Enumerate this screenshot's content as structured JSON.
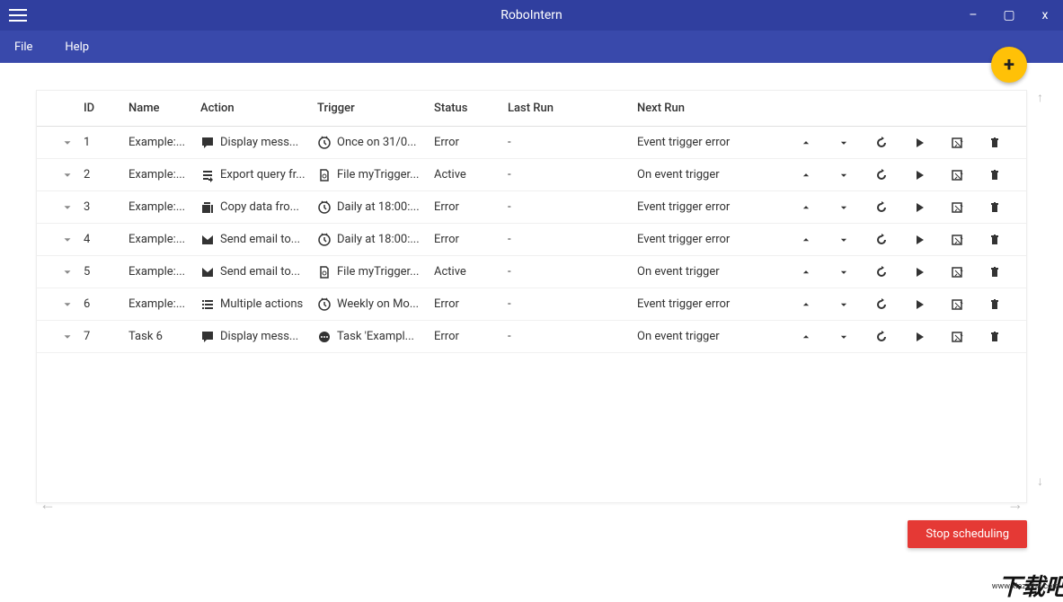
{
  "app": {
    "title": "RoboIntern"
  },
  "menu": {
    "file": "File",
    "help": "Help"
  },
  "fab": {
    "label": "+"
  },
  "table": {
    "headers": {
      "id": "ID",
      "name": "Name",
      "action": "Action",
      "trigger": "Trigger",
      "status": "Status",
      "lastrun": "Last Run",
      "nextrun": "Next Run"
    },
    "rows": [
      {
        "id": "1",
        "name": "Example:...",
        "action_icon": "message",
        "action": "Display mess...",
        "trigger_icon": "clock",
        "trigger": "Once on 31/0...",
        "status": "Error",
        "lastrun": "-",
        "nextrun": "Event trigger error"
      },
      {
        "id": "2",
        "name": "Example:...",
        "action_icon": "export",
        "action": "Export query fr...",
        "trigger_icon": "file",
        "trigger": "File myTrigger...",
        "status": "Active",
        "lastrun": "-",
        "nextrun": "On event trigger"
      },
      {
        "id": "3",
        "name": "Example:...",
        "action_icon": "copy",
        "action": "Copy data fro...",
        "trigger_icon": "clock",
        "trigger": "Daily at 18:00:...",
        "status": "Error",
        "lastrun": "-",
        "nextrun": "Event trigger error"
      },
      {
        "id": "4",
        "name": "Example:...",
        "action_icon": "mail",
        "action": "Send email to...",
        "trigger_icon": "clock",
        "trigger": "Daily at 18:00:...",
        "status": "Error",
        "lastrun": "-",
        "nextrun": "Event trigger error"
      },
      {
        "id": "5",
        "name": "Example:...",
        "action_icon": "mail",
        "action": "Send email to...",
        "trigger_icon": "file",
        "trigger": "File myTrigger...",
        "status": "Active",
        "lastrun": "-",
        "nextrun": "On event trigger"
      },
      {
        "id": "6",
        "name": "Example:...",
        "action_icon": "list",
        "action": "Multiple actions",
        "trigger_icon": "clock",
        "trigger": "Weekly on Mo...",
        "status": "Error",
        "lastrun": "-",
        "nextrun": "Event trigger error"
      },
      {
        "id": "7",
        "name": "Task 6",
        "action_icon": "message",
        "action": "Display mess...",
        "trigger_icon": "dots",
        "trigger": "Task 'Exampl...",
        "status": "Error",
        "lastrun": "-",
        "nextrun": "On event trigger"
      }
    ]
  },
  "buttons": {
    "stop": "Stop scheduling"
  },
  "watermark": {
    "big": "下载吧",
    "url": "www.xiazaiba.com"
  }
}
